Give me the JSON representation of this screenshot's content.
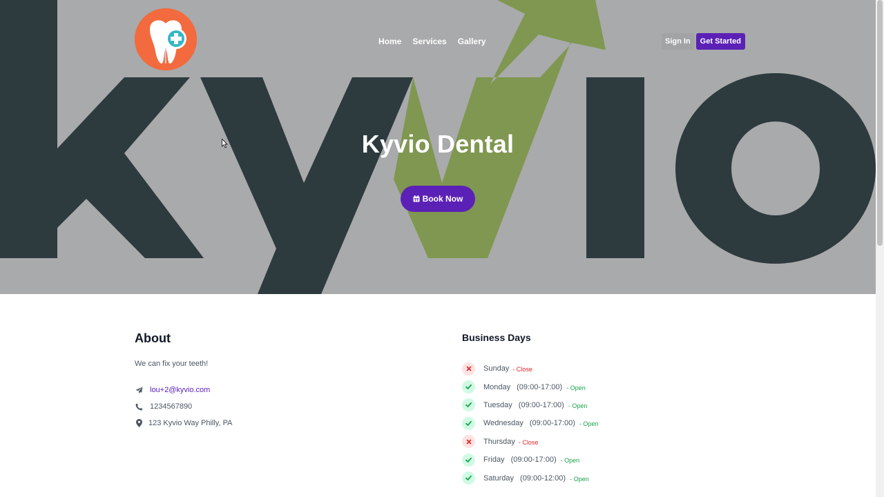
{
  "header": {
    "nav": [
      "Home",
      "Services",
      "Gallery"
    ],
    "sign_in": "Sign In",
    "get_started": "Get Started"
  },
  "hero": {
    "title": "Kyvio Dental",
    "book_label": "Book Now"
  },
  "about": {
    "heading": "About",
    "description": "We can fix your teeth!",
    "email": "lou+2@kyvio.com",
    "phone": "1234567890",
    "address": "123 Kyvio Way Philly, PA"
  },
  "business": {
    "heading": "Business Days",
    "days": [
      {
        "name": "Sunday",
        "hours": "",
        "status": "- Close",
        "open": false
      },
      {
        "name": "Monday",
        "hours": "(09:00-17:00)",
        "status": "- Open",
        "open": true
      },
      {
        "name": "Tuesday",
        "hours": "(09:00-17:00)",
        "status": "- Open",
        "open": true
      },
      {
        "name": "Wednesday",
        "hours": "(09:00-17:00)",
        "status": "- Open",
        "open": true
      },
      {
        "name": "Thursday",
        "hours": "",
        "status": "- Close",
        "open": false
      },
      {
        "name": "Friday",
        "hours": "(09:00-17:00)",
        "status": "- Open",
        "open": true
      },
      {
        "name": "Saturday",
        "hours": "(09:00-12:00)",
        "status": "- Open",
        "open": true
      }
    ]
  },
  "colors": {
    "accent": "#5b21b6",
    "open": "#16a34a",
    "close": "#dc2626",
    "logo": "#f26a3d"
  },
  "icons": {
    "logo": "tooth-plus-logo",
    "book": "calendar-icon",
    "email": "send-icon",
    "phone": "phone-icon",
    "address": "map-pin-icon",
    "open": "check-icon",
    "close": "x-icon"
  }
}
